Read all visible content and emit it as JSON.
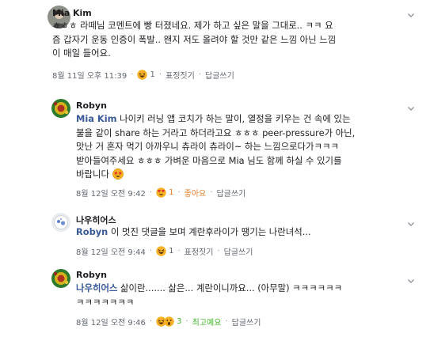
{
  "comments": [
    {
      "author": "Mia Kim",
      "lines": [
        "ㅎㅎㅎ 라떼님 코멘트에 빵 터졌네요. 제가 하고 싶은 말을 그대로.. ㅋㅋ 요",
        "즘 갑자기 운동 인증이 폭발.. 왠지 저도 올려야 할 것만 같은 느낌 아닌 느낌",
        "이 매일 들어요."
      ],
      "timestamp": "8월 11일 오후 11:39",
      "reaction_count": "1",
      "action_label": "표정짓기",
      "reply_label": "답글쓰기"
    },
    {
      "author": "Robyn",
      "mention": "Mia Kim",
      "lines": [
        " 나이키 러닝 앱 코치가 하는 말이, 열정을 키우는 건 속에 있는",
        "불을 같이 share 하는 거라고 하더라고요 ㅎㅎㅎ peer-pressure가 아닌,",
        "맛난 거 혼자 먹기 아까우니 츄라이 츄라이~ 하는 느낌으로다가ㅋㅋㅋ",
        "받아들여주세요 ㅎㅎㅎ 가벼운 마음으로 Mia 님도 함께 하실 수 있기를",
        "바랍니다 "
      ],
      "timestamp": "8월 12일 오전 9:42",
      "reaction_count": "1",
      "action_label": "좋아요",
      "reply_label": "답글쓰기"
    },
    {
      "author": "나우히어스",
      "mention": "Robyn",
      "lines": [
        " 이 멋진 댓글을 보며 계란후라이가 땡기는 나란녀석..."
      ],
      "timestamp": "8월 12일 오전 9:44",
      "reaction_count": "1",
      "action_label": "표정짓기",
      "reply_label": "답글쓰기"
    },
    {
      "author": "Robyn",
      "mention": "나우히어스",
      "lines": [
        " 삶이란....... 삶은... 계란이니까요... (아무말) ㅋㅋㅋㅋㅋㅋ",
        "ㅋㅋㅋㅋㅋㅋㅋ"
      ],
      "timestamp": "8월 12일 오전 9:46",
      "reaction_count": "3",
      "action_label": "최고예요",
      "reply_label": "답글쓰기"
    }
  ],
  "icons": {
    "menu": "chevron-down-icon",
    "laugh": "haha-emoji-icon",
    "love": "love-eyes-emoji-icon",
    "star_struck": "star-eyes-emoji-icon",
    "wow": "wow-emoji-icon"
  },
  "colors": {
    "link": "#385898",
    "meta": "#616770",
    "like_blue": "#4267b2",
    "love_orange": "#e78231",
    "wow_green": "#42b72a"
  }
}
